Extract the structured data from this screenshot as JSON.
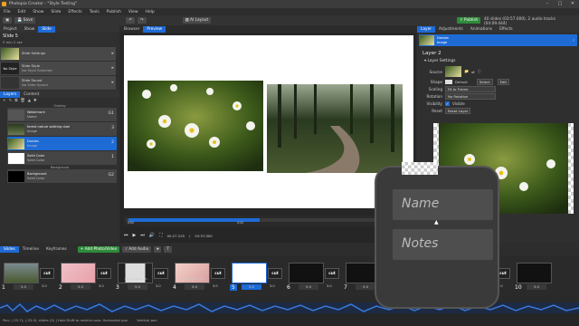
{
  "app": {
    "title": "Photopia Creator - \"Style Testing\"",
    "menu": [
      "File",
      "Edit",
      "Show",
      "Slide",
      "Effects",
      "Tools",
      "Publish",
      "View",
      "Help"
    ]
  },
  "toolbar": {
    "save_label": "Save",
    "layout_label": "AI Layout",
    "publish_label": "Publish",
    "info": "40 slides (03:57.000), 2 audio tracks (04:09.444)"
  },
  "left": {
    "tabs": [
      "Project",
      "Show",
      "Slide"
    ],
    "slide_title": "Slide 5",
    "slide_sub": "5 min 2 sec",
    "settings": [
      {
        "thumb": "",
        "label": "Slide Settings",
        "sub": ""
      },
      {
        "thumb": "No Style",
        "label": "Slide Style",
        "sub": "No Style Selected"
      },
      {
        "thumb": "",
        "label": "Slide Sound",
        "sub": "No Slide Sound"
      }
    ],
    "layer_tabs": [
      "Layers",
      "Content"
    ],
    "groups": {
      "overlay": "Overlay",
      "background": "Background"
    },
    "layers": [
      {
        "name": "Watermark",
        "sub": "Name",
        "num": "G1"
      },
      {
        "name": "forest nature walking duel",
        "sub": "Image",
        "num": "3"
      },
      {
        "name": "Daisies",
        "sub": "Image",
        "num": "2"
      },
      {
        "name": "Solid Color",
        "sub": "Solid Color",
        "num": "1"
      },
      {
        "name": "Background",
        "sub": "Solid Color",
        "num": "G2"
      }
    ]
  },
  "center": {
    "tabs": [
      "Browser",
      "Preview"
    ],
    "time_current": "00:27.225",
    "time_total": "03:57.000",
    "ruler": [
      "0:00",
      "",
      "0:20",
      ""
    ]
  },
  "right": {
    "tabs": [
      "Layer",
      "Adjustments",
      "Animations",
      "Effects"
    ],
    "selected_layer": {
      "name": "Daisies",
      "sub": "Image"
    },
    "heading": "Layer 2",
    "section": "Layer Settings",
    "source_label": "Source",
    "shape_label": "Shape",
    "shape_value": "Default",
    "select_label": "Select",
    "edit_label": "Edit",
    "scaling_label": "Scaling",
    "scaling_value": "Fit to Frame",
    "rotation_label": "Rotation",
    "rotation_value": "No Rotation",
    "visibility_label": "Visibility",
    "visible_label": "Visible",
    "reset_label": "Reset",
    "reset_button": "Reset Layer"
  },
  "bottom": {
    "tabs": [
      "Slides",
      "Timeline",
      "Keyframes"
    ],
    "add_photo": "Add Photo/Video",
    "add_audio": "Add Audio"
  },
  "slides": [
    {
      "num": "1",
      "dur": "5.0",
      "tdur": "3.0"
    },
    {
      "num": "2",
      "dur": "5.0",
      "tdur": "3.0"
    },
    {
      "num": "3",
      "dur": "5.0",
      "tdur": "3.0",
      "caption": "Vertical Slide - T..."
    },
    {
      "num": "4",
      "dur": "5.0",
      "tdur": "3.0",
      "caption": "Christmas Card T..."
    },
    {
      "num": "5",
      "dur": "3.0",
      "tdur": "3.0"
    },
    {
      "num": "6",
      "dur": "5.0",
      "tdur": "3.0"
    },
    {
      "num": "7",
      "dur": "5.0",
      "tdur": "3.0"
    },
    {
      "num": "8",
      "dur": "5.0",
      "tdur": "3.0"
    },
    {
      "num": "9",
      "dur": "5.0",
      "tdur": "3.0"
    },
    {
      "num": "10",
      "dur": "5.0",
      "tdur": "3.0"
    }
  ],
  "cut_label": "cut",
  "status": {
    "left": "Pan: (-25.7); (-25.0); slides (5) | Hold Shift to restrict axis: Horizontal pan",
    "right": "Vertical pan"
  },
  "bubble": {
    "name_label": "Name",
    "notes_label": "Notes"
  },
  "colors": {
    "accent": "#1e6bd6",
    "publish": "#2e8b3a",
    "background": "#2b2b2b"
  }
}
